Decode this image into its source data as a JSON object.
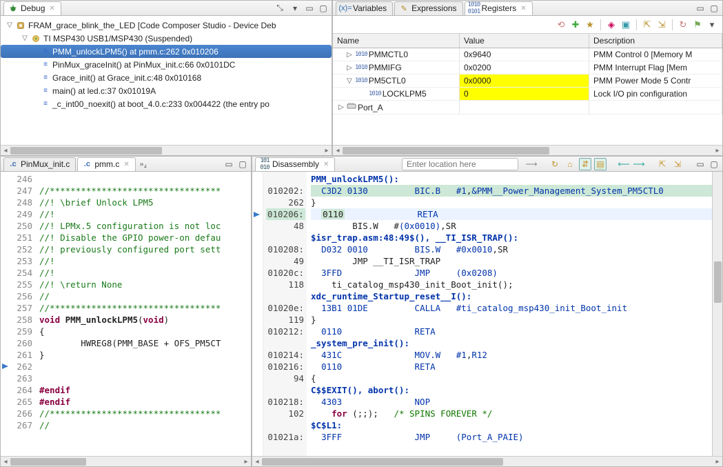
{
  "debug": {
    "tab": "Debug",
    "project": "FRAM_grace_blink_the_LED [Code Composer Studio - Device Deb",
    "target": "TI MSP430 USB1/MSP430 (Suspended)",
    "stack": [
      "PMM_unlockLPM5() at pmm.c:262 0x010206",
      "PinMux_graceInit() at PinMux_init.c:66 0x0101DC",
      "Grace_init() at Grace_init.c:48 0x010168",
      "main() at led.c:37 0x01019A",
      "_c_int00_noexit() at boot_4.0.c:233 0x004422  (the entry po"
    ]
  },
  "upperTabs": {
    "variables": "Variables",
    "expressions": "Expressions",
    "registers": "Registers"
  },
  "registers": {
    "headers": {
      "name": "Name",
      "value": "Value",
      "desc": "Description"
    },
    "rows": [
      {
        "name": "PMMCTL0",
        "value": "0x9640",
        "desc": "PMM Control 0 [Memory M",
        "indent": 1,
        "twisty": "▷",
        "hl": false
      },
      {
        "name": "PMMIFG",
        "value": "0x0200",
        "desc": "PMM Interrupt Flag [Mem",
        "indent": 1,
        "twisty": "▷",
        "hl": false
      },
      {
        "name": "PM5CTL0",
        "value": "0x0000",
        "desc": "PMM Power Mode 5 Contr",
        "indent": 1,
        "twisty": "▽",
        "hl": true
      },
      {
        "name": "LOCKLPM5",
        "value": "0",
        "desc": "Lock I/O pin configuration",
        "indent": 2,
        "twisty": "",
        "hl": true
      },
      {
        "name": "Port_A",
        "value": "",
        "desc": "",
        "indent": 0,
        "twisty": "▷",
        "hl": false,
        "port": true
      }
    ]
  },
  "editorTabs": {
    "pinmux": "PinMux_init.c",
    "pmm": "pmm.c",
    "overflow": "»₄"
  },
  "source": {
    "first_line": 246,
    "lines": [
      "",
      "//*********************************",
      "//! \\brief Unlock LPM5",
      "//!",
      "//! LPMx.5 configuration is not loc",
      "//! Disable the GPIO power-on defau",
      "//! previously configured port sett",
      "//!",
      "//!",
      "//! \\return None",
      "//",
      "//*********************************",
      "void PMM_unlockLPM5(void)",
      "{",
      "        HWREG8(PMM_BASE + OFS_PM5CT",
      "}",
      "",
      "",
      "#endif",
      "#endif",
      "//*********************************",
      "//"
    ],
    "current_line_index": 16
  },
  "disasm": {
    "tab": "Disassembly",
    "location_placeholder": "Enter location here",
    "lines": [
      {
        "addr": "",
        "text": "PMM_unlockLPM5():",
        "sym": true
      },
      {
        "addr": "010202:",
        "text": "  C3D2 0130         BIC.B   #1,&PMM__Power_Management_System_PM5CTL0",
        "hl": "green"
      },
      {
        "addr": "262",
        "text": "}",
        "src": true
      },
      {
        "addr": "010206:",
        "text": "  0110              RETA",
        "current": true
      },
      {
        "addr": "48",
        "text": "        BIS.W   #(0x0010),SR",
        "src": true
      },
      {
        "addr": "",
        "text": "$isr_trap.asm:48:49$(), __TI_ISR_TRAP():",
        "sym": true
      },
      {
        "addr": "010208:",
        "text": "  D032 0010         BIS.W   #0x0010,SR"
      },
      {
        "addr": "49",
        "text": "        JMP __TI_ISR_TRAP",
        "src": true
      },
      {
        "addr": "01020c:",
        "text": "  3FFD              JMP     (0x0208)"
      },
      {
        "addr": "118",
        "text": "    ti_catalog_msp430_init_Boot_init();",
        "src": true
      },
      {
        "addr": "",
        "text": "xdc_runtime_Startup_reset__I():",
        "sym": true
      },
      {
        "addr": "01020e:",
        "text": "  13B1 01DE         CALLA   #ti_catalog_msp430_init_Boot_init"
      },
      {
        "addr": "119",
        "text": "}",
        "src": true
      },
      {
        "addr": "010212:",
        "text": "  0110              RETA"
      },
      {
        "addr": "",
        "text": "_system_pre_init():",
        "sym": true
      },
      {
        "addr": "010214:",
        "text": "  431C              MOV.W   #1,R12"
      },
      {
        "addr": "010216:",
        "text": "  0110              RETA"
      },
      {
        "addr": " 94",
        "text": "{",
        "src": true
      },
      {
        "addr": "",
        "text": "C$$EXIT(), abort():",
        "sym": true
      },
      {
        "addr": "010218:",
        "text": "  4303              NOP"
      },
      {
        "addr": "102",
        "text": "    for (;;);   /* SPINS FOREVER */",
        "srcfor": true
      },
      {
        "addr": "",
        "text": "$C$L1:",
        "sym": true
      },
      {
        "addr": "01021a:",
        "text": "  3FFF              JMP     (Port_A_PAIE)"
      }
    ]
  }
}
